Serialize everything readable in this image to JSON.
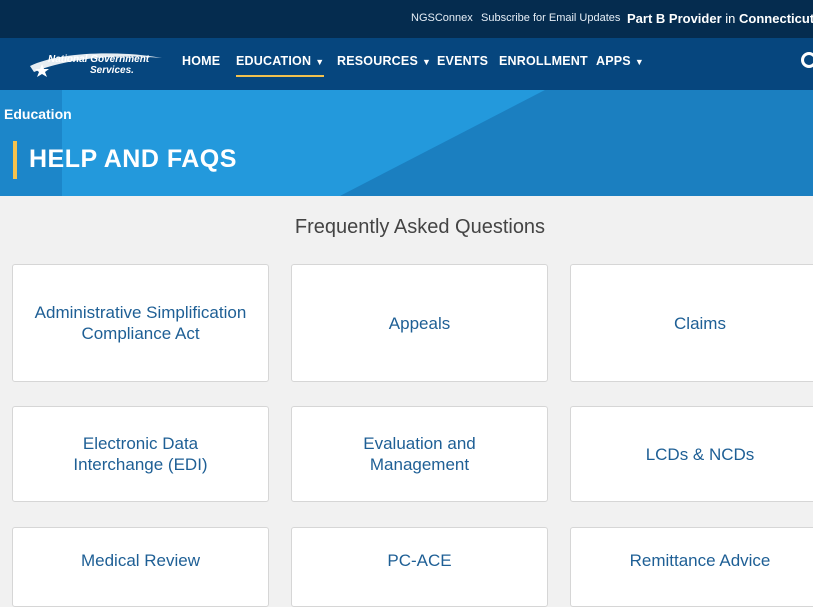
{
  "utility": {
    "links": [
      "NGSConnex",
      "Subscribe for Email Updates"
    ],
    "portal_role": "Part B Provider",
    "portal_in": "in",
    "portal_state": "Connecticut"
  },
  "logo": {
    "line1": "National Government",
    "line2": "Services."
  },
  "nav": {
    "items": [
      {
        "label": "HOME",
        "dropdown": false
      },
      {
        "label": "EDUCATION",
        "dropdown": true,
        "active": true
      },
      {
        "label": "RESOURCES",
        "dropdown": true
      },
      {
        "label": "EVENTS",
        "dropdown": false
      },
      {
        "label": "ENROLLMENT",
        "dropdown": false
      },
      {
        "label": "APPS",
        "dropdown": true
      }
    ]
  },
  "hero": {
    "breadcrumb": "Education",
    "title": "HELP AND FAQS"
  },
  "faq": {
    "heading": "Frequently Asked Questions",
    "cards": [
      "Administrative Simplification Compliance Act",
      "Appeals",
      "Claims",
      "Electronic Data Interchange (EDI)",
      "Evaluation and Management",
      "LCDs & NCDs",
      "Medical Review",
      "PC-ACE",
      "Remittance Advice"
    ]
  },
  "colors": {
    "utility_bg": "#052c4f",
    "nav_bg": "#06467e",
    "hero_bg": "#1d8bd0",
    "accent": "#f5c24d",
    "card_text": "#1e5f95"
  }
}
